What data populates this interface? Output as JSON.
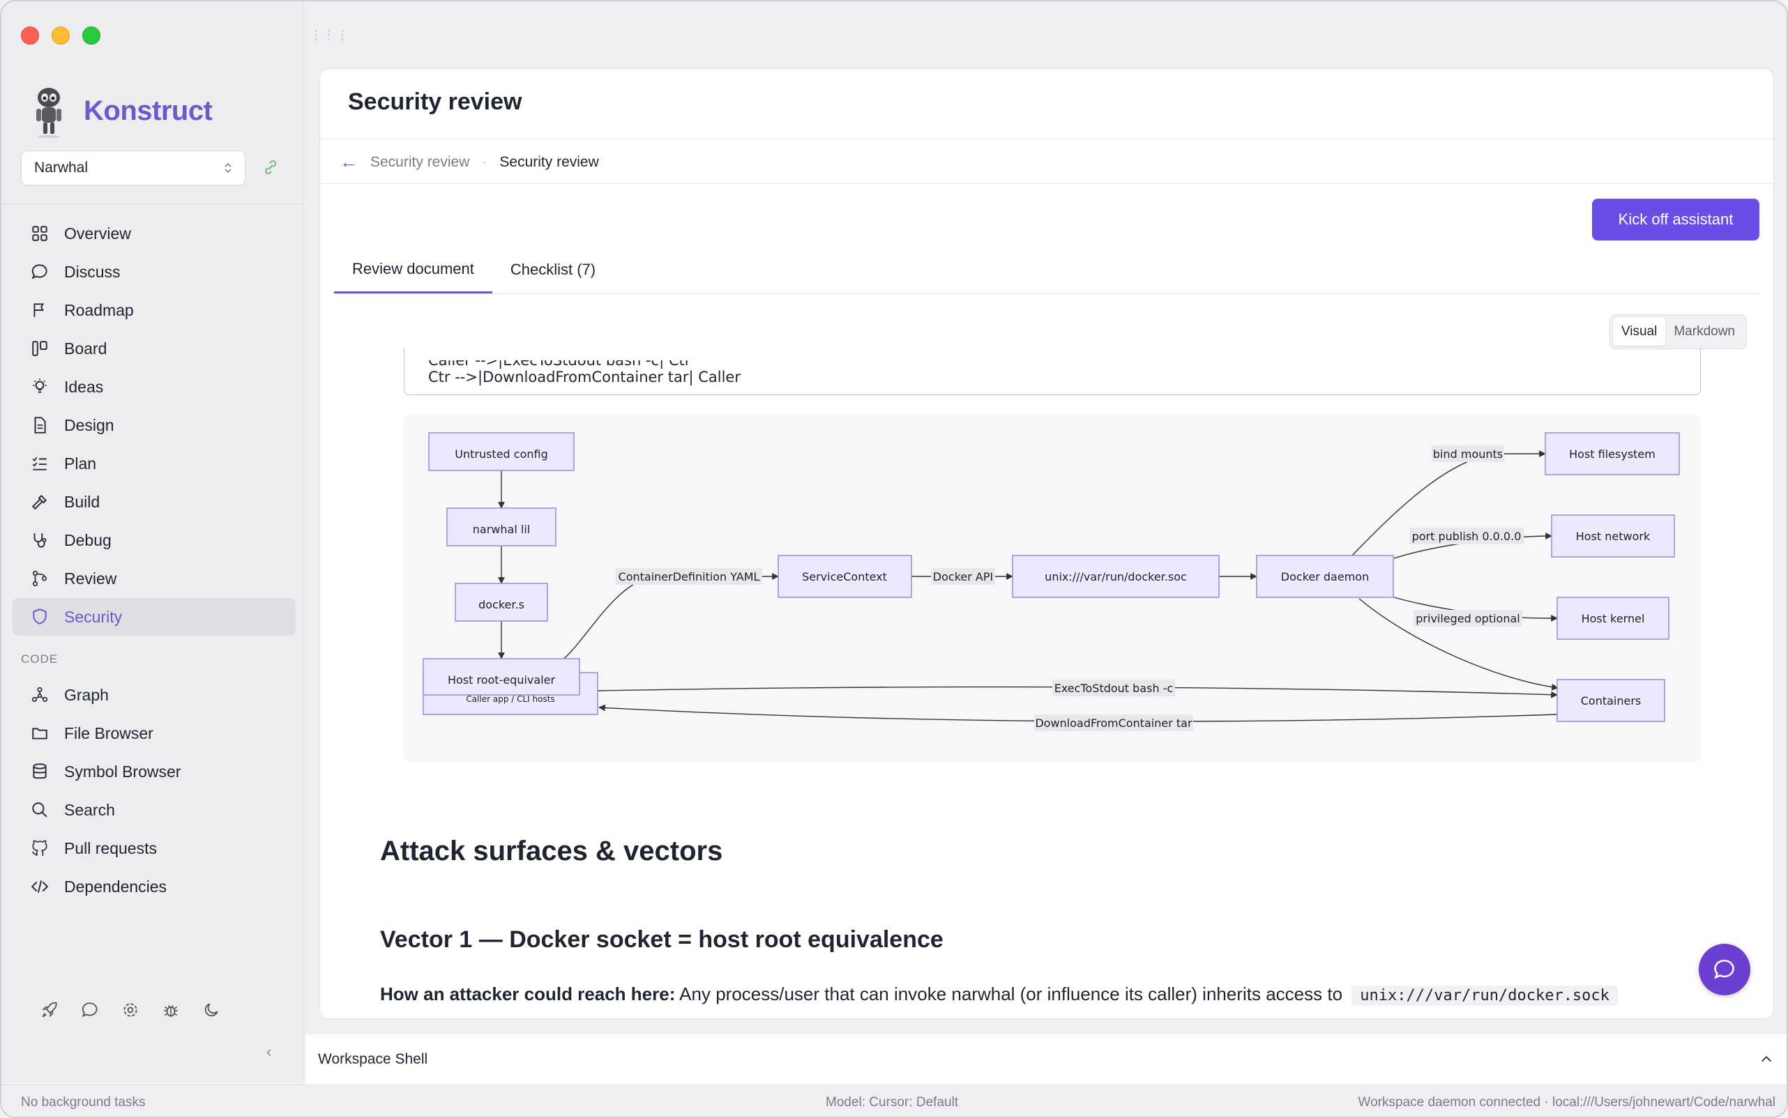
{
  "app": {
    "name": "Konstruct"
  },
  "project": {
    "selected": "Narwhal"
  },
  "sidebar": {
    "items": [
      {
        "label": "Overview",
        "icon": "grid-icon"
      },
      {
        "label": "Discuss",
        "icon": "chat-bubble-icon"
      },
      {
        "label": "Roadmap",
        "icon": "flag-icon"
      },
      {
        "label": "Board",
        "icon": "kanban-icon"
      },
      {
        "label": "Ideas",
        "icon": "lightbulb-icon"
      },
      {
        "label": "Design",
        "icon": "document-icon"
      },
      {
        "label": "Plan",
        "icon": "checklist-icon"
      },
      {
        "label": "Build",
        "icon": "hammer-icon"
      },
      {
        "label": "Debug",
        "icon": "stethoscope-icon"
      },
      {
        "label": "Review",
        "icon": "git-compare-icon"
      },
      {
        "label": "Security",
        "icon": "shield-icon",
        "active": true
      }
    ],
    "code_section_label": "CODE",
    "code_items": [
      {
        "label": "Graph",
        "icon": "graph-icon"
      },
      {
        "label": "File Browser",
        "icon": "folder-icon"
      },
      {
        "label": "Symbol Browser",
        "icon": "database-icon"
      },
      {
        "label": "Search",
        "icon": "search-icon"
      },
      {
        "label": "Pull requests",
        "icon": "github-icon"
      },
      {
        "label": "Dependencies",
        "icon": "code-icon"
      }
    ]
  },
  "page": {
    "title": "Security review",
    "breadcrumb_parent": "Security review",
    "breadcrumb_current": "Security review",
    "kick_off_label": "Kick off assistant",
    "tabs": [
      {
        "label": "Review document",
        "active": true
      },
      {
        "label": "Checklist (7)",
        "active": false
      }
    ],
    "view_toggle": {
      "visual": "Visual",
      "markdown": "Markdown",
      "selected": "Visual"
    }
  },
  "document": {
    "code_lines": [
      "Caller -->|ExecToStdout bash -c| Ctr",
      "Ctr -->|DownloadFromContainer tar| Caller"
    ],
    "diagram": {
      "nodes": {
        "untrusted": "Untrusted config",
        "narwhal": "narwhal lil",
        "docker_s": "docker.s",
        "host_root": "Host root-equivaler",
        "caller_app": "Caller app / CLI hosts",
        "service": "ServiceContext",
        "socket": "unix:///var/run/docker.soc",
        "daemon": "Docker daemon",
        "host_fs": "Host filesystem",
        "host_net": "Host network",
        "host_kernel": "Host kernel",
        "containers": "Containers"
      },
      "edges": {
        "container_def": "ContainerDefinition YAML",
        "docker_api": "Docker API",
        "bind_mounts": "bind mounts",
        "port_publish": "port publish 0.0.0.0",
        "privileged": "privileged optional",
        "exec": "ExecToStdout bash -c",
        "download": "DownloadFromContainer tar"
      }
    },
    "heading": "Attack surfaces & vectors",
    "subheading": "Vector 1 — Docker socket = host root equivalence",
    "paragraph_bold": "How an attacker could reach here:",
    "paragraph_text": "Any process/user that can invoke narwhal (or influence its caller) inherits access to",
    "paragraph_code": "unix:///var/run/docker.sock"
  },
  "shell": {
    "title": "Workspace Shell"
  },
  "status": {
    "left": "No background tasks",
    "center": "Model: Cursor: Default",
    "right": "Workspace daemon connected · local:///Users/johnewart/Code/narwhal"
  },
  "colors": {
    "accent": "#6a5acd",
    "button": "#6b4ce6",
    "fab": "#6a3fd1"
  }
}
